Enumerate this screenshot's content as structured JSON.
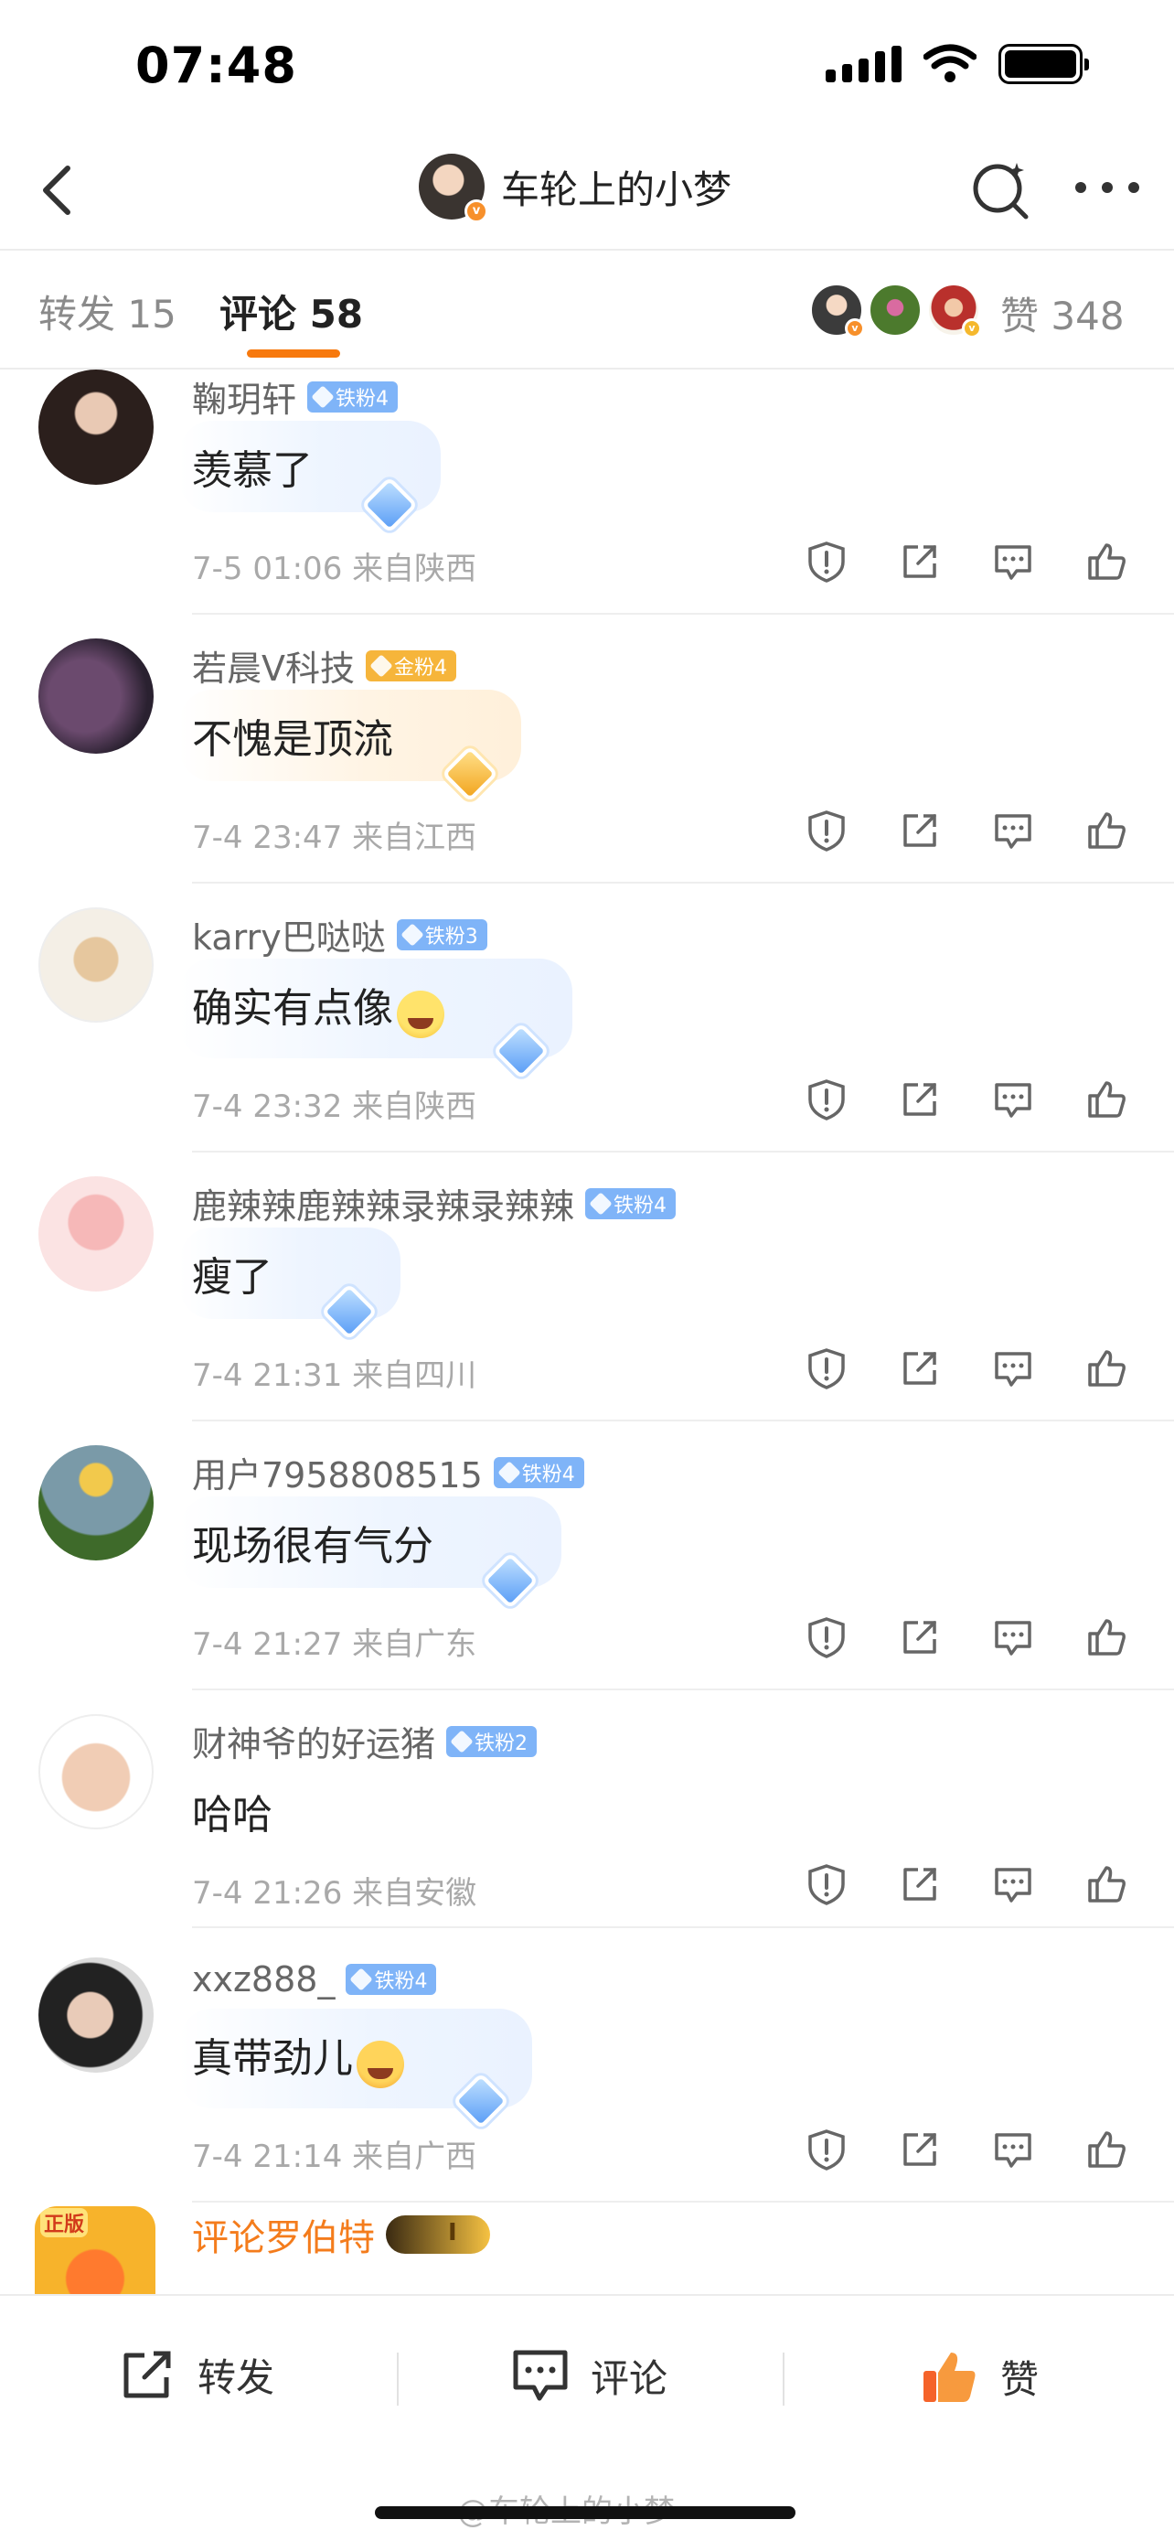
{
  "status": {
    "time": "07:48"
  },
  "nav": {
    "title": "车轮上的小梦"
  },
  "tabs": {
    "repost_label": "转发",
    "repost_count": "15",
    "comment_label": "评论",
    "comment_count": "58",
    "like_label": "赞",
    "like_count": "348"
  },
  "comments": [
    {
      "name": "鞠玥轩",
      "badge": "铁粉4",
      "text": "羡慕了",
      "meta": "7-5 01:06 来自陕西"
    },
    {
      "name": "若晨Ⅴ科技",
      "badge": "金粉4",
      "text": "不愧是顶流",
      "meta": "7-4 23:47 来自江西"
    },
    {
      "name": "karry巴哒哒",
      "badge": "铁粉3",
      "text": "确实有点像",
      "meta": "7-4 23:32 来自陕西"
    },
    {
      "name": "鹿辣辣鹿辣辣录辣录辣辣",
      "badge": "铁粉4",
      "text": "瘦了",
      "meta": "7-4 21:31 来自四川"
    },
    {
      "name": "用户7958808515",
      "badge": "铁粉4",
      "text": "现场很有气分",
      "meta": "7-4 21:27 来自广东"
    },
    {
      "name": "财神爷的好运猪",
      "badge": "铁粉2",
      "text": "哈哈",
      "meta": "7-4 21:26 来自安徽"
    },
    {
      "name": "xxz888_",
      "badge": "铁粉4",
      "text": "真带劲儿",
      "meta": "7-4 21:14 来自广西"
    }
  ],
  "partial_comment": {
    "name": "评论罗伯特",
    "avatar_tag": "正版"
  },
  "bottom": {
    "repost": "转发",
    "comment": "评论",
    "like": "赞"
  },
  "watermark": "@车轮上的小梦",
  "colors": {
    "accent": "#f7790e",
    "iron_badge": "#7fb4f8",
    "gold_badge": "#f6b53b",
    "like_active": "#f5632a"
  }
}
